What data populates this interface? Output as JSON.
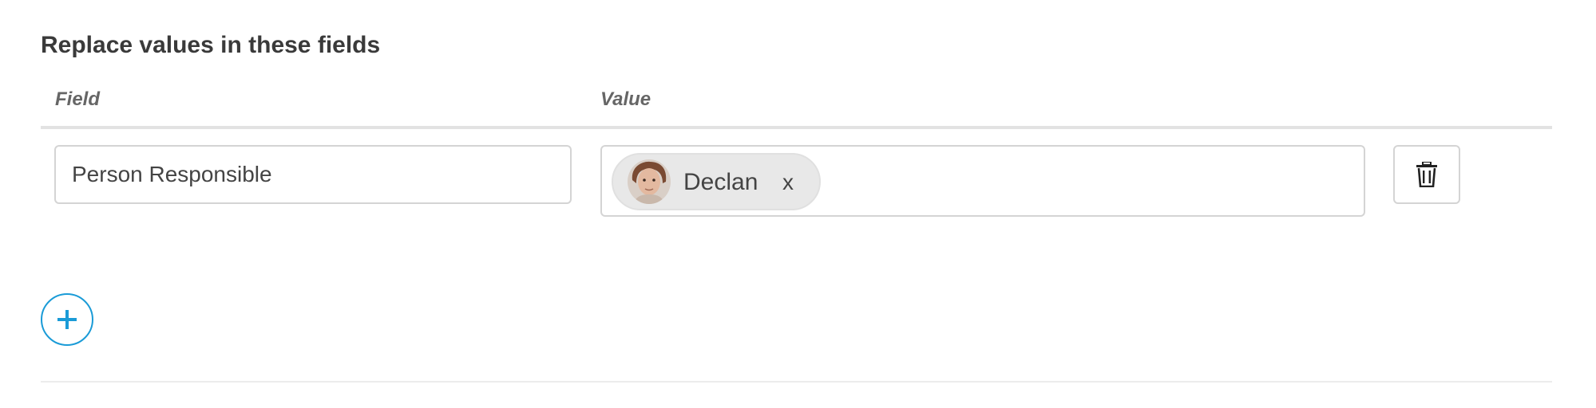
{
  "section": {
    "title": "Replace values in these fields"
  },
  "columns": {
    "field_header": "Field",
    "value_header": "Value"
  },
  "rows": [
    {
      "field_value": "Person Responsible",
      "value_chips": [
        {
          "label": "Declan",
          "remove_label": "x",
          "avatar_icon": "person-avatar"
        }
      ],
      "delete_icon": "trash-icon"
    }
  ],
  "actions": {
    "add_icon": "plus-icon"
  },
  "colors": {
    "accent": "#1a9bd7",
    "border": "#d4d4d4",
    "chip_background": "#e8e8e8",
    "text": "#333333"
  }
}
